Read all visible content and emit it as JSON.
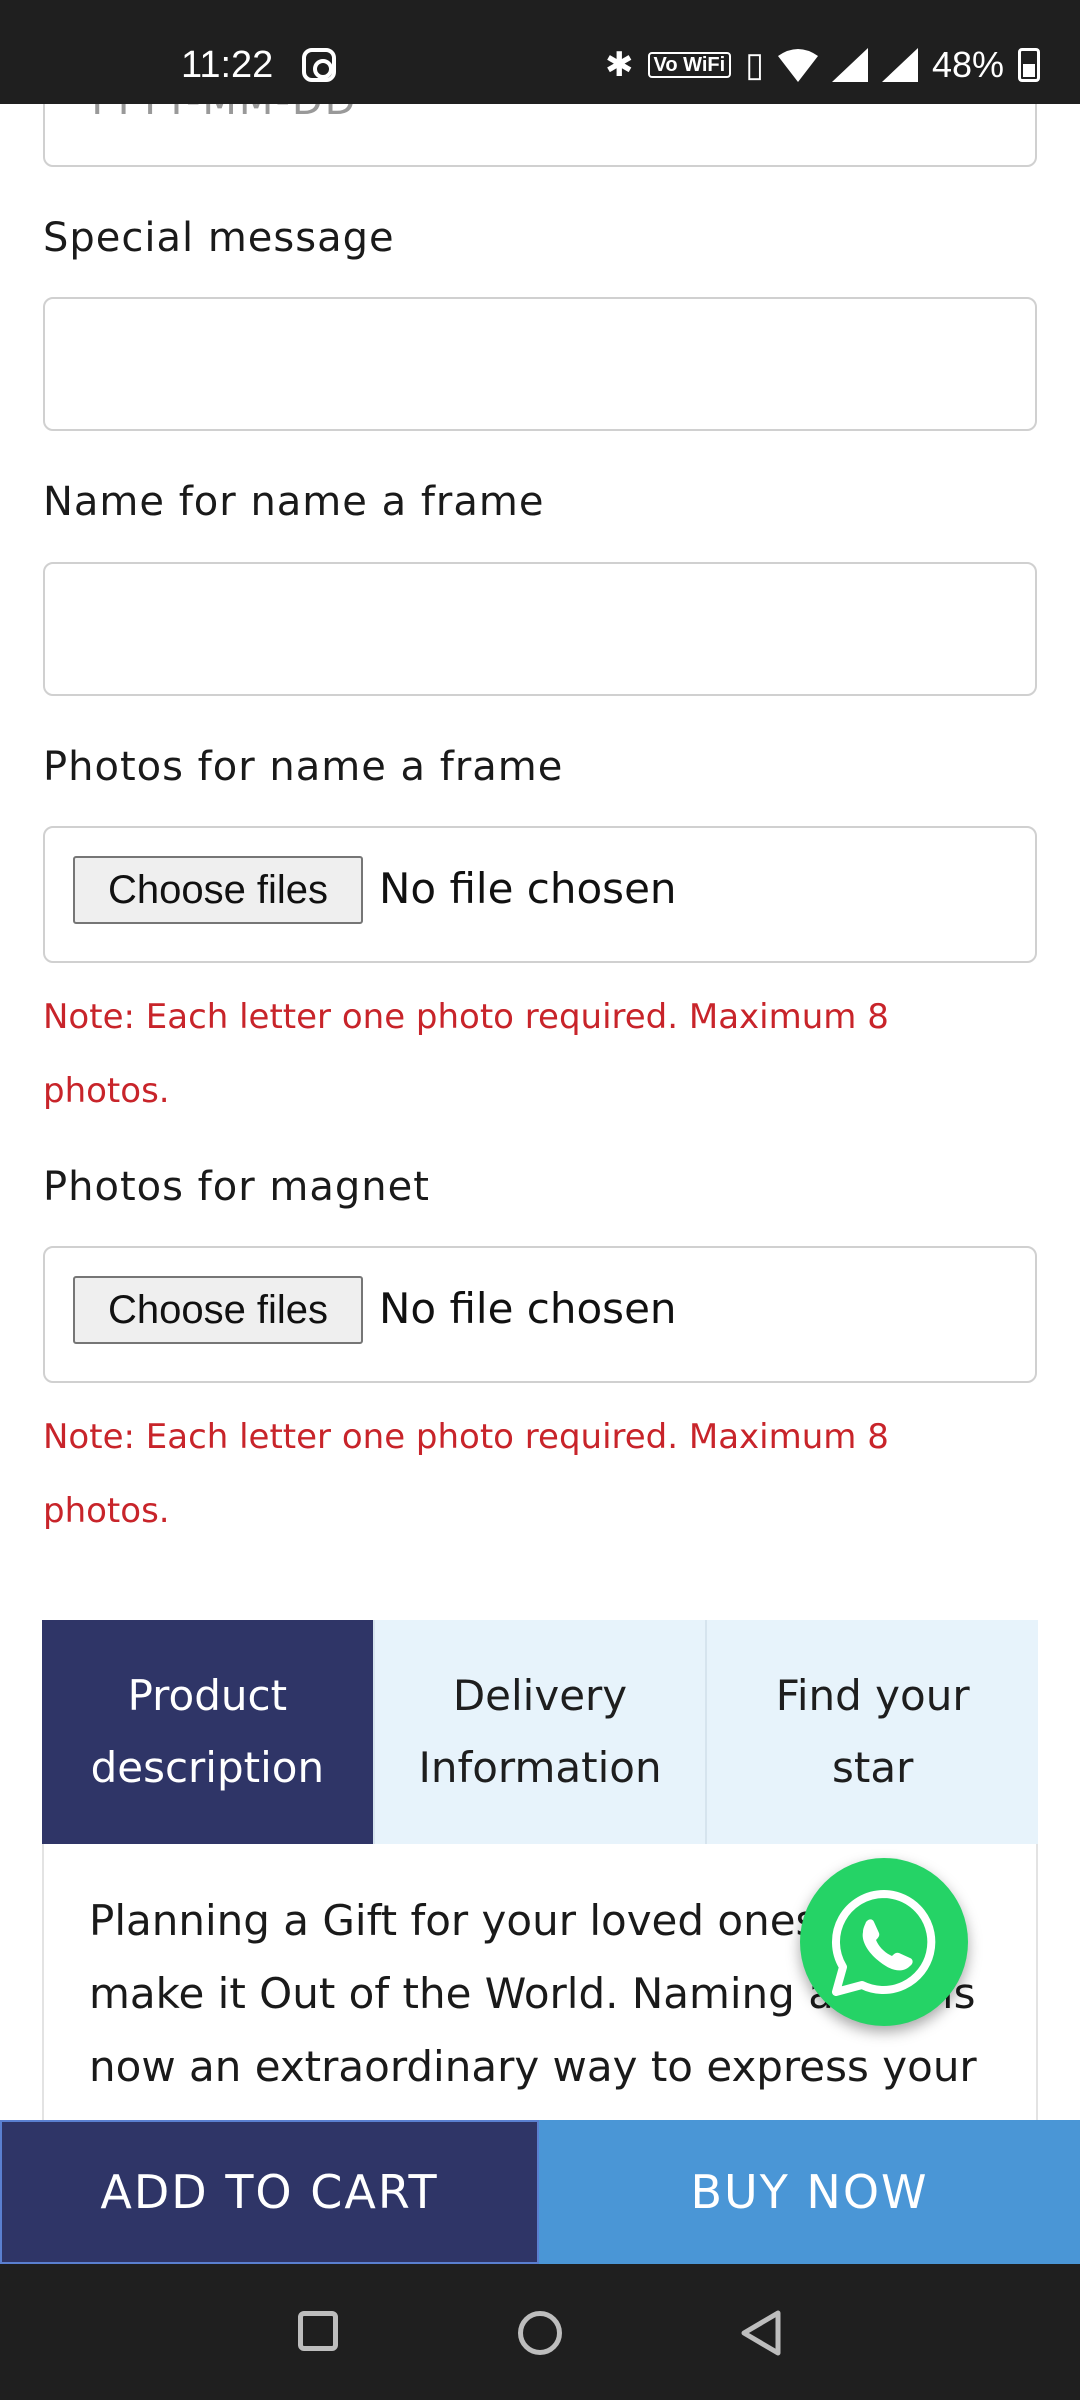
{
  "status_bar": {
    "time": "11:22",
    "battery": "48%",
    "icons": [
      "instagram-icon",
      "bluetooth-icon",
      "vowifi-icon",
      "vibrate-icon",
      "wifi-icon",
      "signal-icon",
      "signal-icon",
      "battery-icon"
    ],
    "volte_label": "Vo WiFi"
  },
  "form": {
    "date_placeholder": "YYYY-MM-DD",
    "special_message_label": "Special message",
    "name_frame_label": "Name for name a frame",
    "photos_frame_label": "Photos for name a frame",
    "photos_magnet_label": "Photos for magnet",
    "choose_files": "Choose files",
    "no_file": "No file chosen",
    "note_line1": "Note: Each letter one photo required. Maximum 8",
    "note_line2": "photos."
  },
  "tabs": {
    "product_line1": "Product",
    "product_line2": "description",
    "delivery_line1": "Delivery",
    "delivery_line2": "Information",
    "star_line1": "Find your",
    "star_line2": "star"
  },
  "description": {
    "line1": "Planning a Gift for your loved ones...",
    "line2": "make it Out of the World. Naming a star is",
    "line3": "now an extraordinary way to express your"
  },
  "actions": {
    "add_to_cart": "ADD TO CART",
    "buy_now": "BUY NOW"
  },
  "colors": {
    "primary": "#2f3567",
    "accent": "#4a96d6",
    "note": "#c8242a",
    "whatsapp": "#25d366"
  }
}
